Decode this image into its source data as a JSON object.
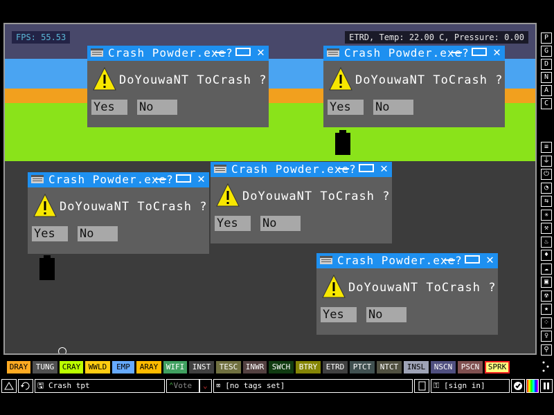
{
  "hud": {
    "fps": "FPS: 55.53",
    "status": "ETRD, Temp: 22.00 C, Pressure: 0.00"
  },
  "dialogs": [
    {
      "title": "Crash Powder.exe?",
      "message": "DoYouwaNT ToCrash ?",
      "yes": "Yes",
      "no": "No"
    },
    {
      "title": "Crash Powder.exe?",
      "message": "DoYouwaNT ToCrash ?",
      "yes": "Yes",
      "no": "No"
    },
    {
      "title": "Crash Powder.exe?",
      "message": "DoYouwaNT ToCrash ?",
      "yes": "Yes",
      "no": "No"
    },
    {
      "title": "Crash Powder.exe?",
      "message": "DoYouwaNT ToCrash ?",
      "yes": "Yes",
      "no": "No"
    },
    {
      "title": "Crash Powder.exe?",
      "message": "DoYouwaNT ToCrash ?",
      "yes": "Yes",
      "no": "No"
    }
  ],
  "side_letters": [
    "P",
    "G",
    "D",
    "N",
    "A",
    "C"
  ],
  "side_icons": [
    "menu-icon",
    "plug-icon",
    "power-icon",
    "sensor-icon",
    "force-icon",
    "explosive-icon",
    "tools-icon",
    "fire-icon",
    "droplet-icon",
    "gas-icon",
    "box-icon",
    "radiation-icon",
    "star-icon",
    "dots-icon",
    "life-icon",
    "search-icon"
  ],
  "elements": [
    {
      "label": "DRAY",
      "color": "#ffaa22"
    },
    {
      "label": "TUNG",
      "color": "#505050"
    },
    {
      "label": "CRAY",
      "color": "#bbff00"
    },
    {
      "label": "WWLD",
      "color": "#ffcc11"
    },
    {
      "label": "EMP",
      "color": "#66aaff"
    },
    {
      "label": "ARAY",
      "color": "#ffbb00"
    },
    {
      "label": "WIFI",
      "color": "#40a060"
    },
    {
      "label": "INST",
      "color": "#404040"
    },
    {
      "label": "TESC",
      "color": "#707040"
    },
    {
      "label": "INWR",
      "color": "#544141"
    },
    {
      "label": "SWCH",
      "color": "#103b11"
    },
    {
      "label": "BTRY",
      "color": "#858505"
    },
    {
      "label": "ETRD",
      "color": "#404040"
    },
    {
      "label": "PTCT",
      "color": "#405050"
    },
    {
      "label": "NTCT",
      "color": "#505040"
    },
    {
      "label": "INSL",
      "color": "#9ea3b6"
    },
    {
      "label": "NSCN",
      "color": "#505080"
    },
    {
      "label": "PSCN",
      "color": "#805050"
    },
    {
      "label": "SPRK",
      "color": "#ffff80"
    }
  ],
  "bottom": {
    "save_name": "Crash tpt",
    "vote": "Vote",
    "tags": "[no tags set]",
    "signin": "[sign in]"
  }
}
